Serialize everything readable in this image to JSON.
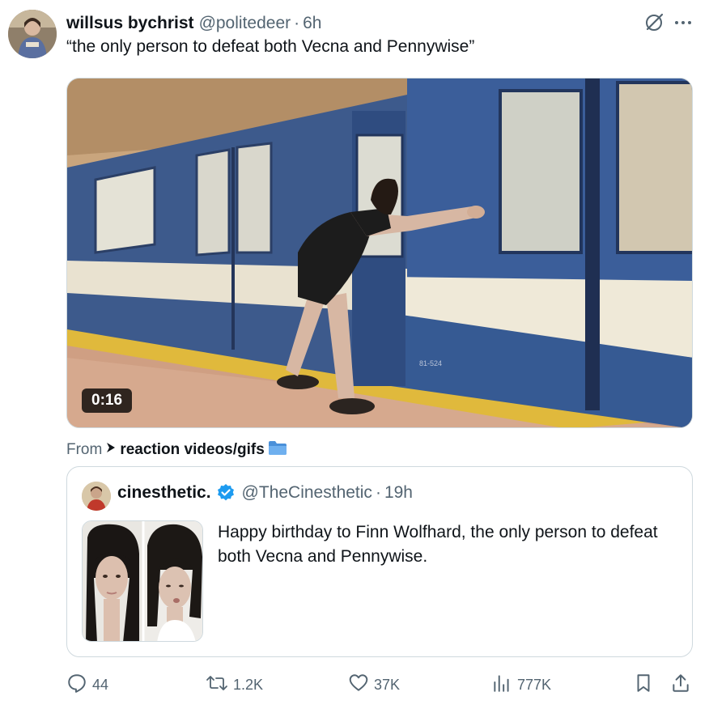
{
  "tweet": {
    "author": {
      "display_name": "willsus bychrist",
      "handle": "@politedeer",
      "separator": "·",
      "time": "6h",
      "avatar_icon": "user-avatar"
    },
    "text": "“the only person to defeat both Vecna and Pennywise”",
    "media": {
      "type": "video",
      "duration": "0:16",
      "train_number": "81-524"
    },
    "from": {
      "prefix": "From",
      "community": "reaction videos/gifs",
      "community_emoji": "📁"
    },
    "header_icons": [
      "grok-icon",
      "more-icon"
    ]
  },
  "quote": {
    "author": {
      "display_name": "cinesthetic.",
      "verified": true,
      "handle": "@TheCinesthetic",
      "separator": "·",
      "time": "19h"
    },
    "text": "Happy birthday to Finn Wolfhard, the only person to defeat both Vecna and Pennywise."
  },
  "actions": {
    "replies": "44",
    "reposts": "1.2K",
    "likes": "37K",
    "views": "777K"
  },
  "colors": {
    "text_primary": "#0f1419",
    "text_secondary": "#536471",
    "border": "#cfd9de",
    "verified_blue": "#1d9bf0"
  }
}
